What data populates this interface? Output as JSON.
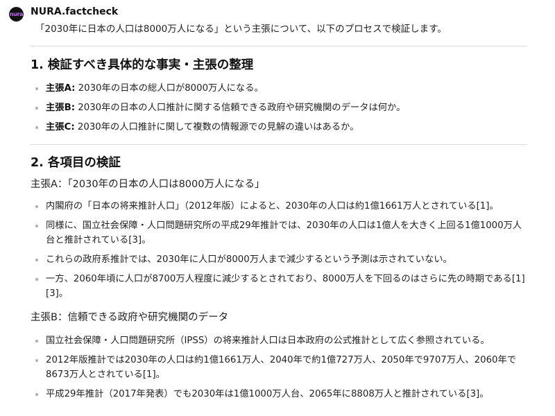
{
  "header": {
    "avatar_text": "nura",
    "sender_name": "NURA.factcheck",
    "intro": "「2030年に日本の人口は8000万人になる」という主張について、以下のプロセスで検証します。"
  },
  "section1": {
    "heading": "1. 検証すべき具体的な事実・主張の整理",
    "items": [
      {
        "label": "主張A:",
        "text": " 2030年の日本の総人口が8000万人になる。"
      },
      {
        "label": "主張B:",
        "text": " 2030年の日本の人口推計に関する信頼できる政府や研究機関のデータは何か。"
      },
      {
        "label": "主張C:",
        "text": " 2030年の人口推計に関して複数の情報源での見解の違いはあるか。"
      }
    ]
  },
  "section2": {
    "heading": "2. 各項目の検証",
    "claimA": {
      "subheading": "主張A：「2030年の日本の人口は8000万人になる」",
      "items": [
        "内閣府の「日本の将来推計人口」（2012年版）によると、2030年の人口は約1億1661万人とされている[1]。",
        "同様に、国立社会保障・人口問題研究所の平成29年推計では、2030年の人口は1億人を大きく上回る1億1000万人台と推計されている[3]。",
        "これらの政府系推計では、2030年に人口が8000万人まで減少するという予測は示されていない。",
        "一方、2060年頃に人口が8700万人程度に減少するとされており、8000万人を下回るのはさらに先の時期である[1][3]。"
      ]
    },
    "claimB": {
      "subheading": "主張B：信頼できる政府や研究機関のデータ",
      "items": [
        "国立社会保障・人口問題研究所（IPSS）の将来推計人口は日本政府の公式推計として広く参照されている。",
        "2012年版推計では2030年の人口は約1億1661万人、2040年で約1億727万人、2050年で9707万人、2060年で8673万人とされている[1]。",
        "平成29年推計（2017年発表）でも2030年は1億1000万人台、2065年に8808万人と推計されている[3]。"
      ]
    }
  }
}
